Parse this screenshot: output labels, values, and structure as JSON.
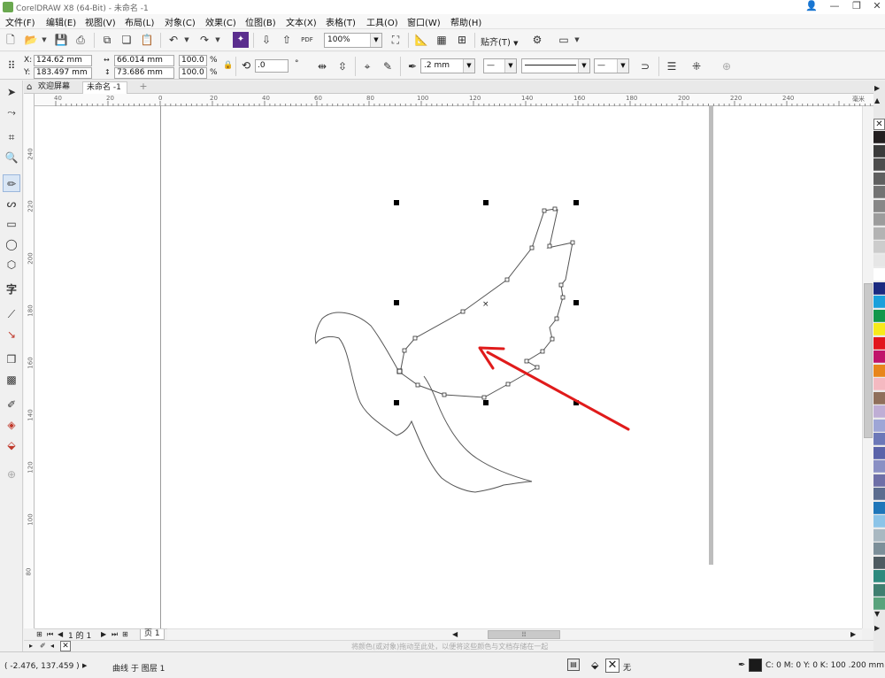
{
  "window": {
    "title": "CorelDRAW X8 (64-Bit) - 未命名 -1"
  },
  "menu": [
    "文件(F)",
    "编辑(E)",
    "视图(V)",
    "布局(L)",
    "对象(C)",
    "效果(C)",
    "位图(B)",
    "文本(X)",
    "表格(T)",
    "工具(O)",
    "窗口(W)",
    "帮助(H)"
  ],
  "toolbar": {
    "zoom": "100%",
    "snap_label": "贴齐(T)",
    "pdf_label": "PDF"
  },
  "property_bar": {
    "x": "124.62 mm",
    "y": "183.497 mm",
    "width": "66.014 mm",
    "height": "73.686 mm",
    "scale_w": "100.0",
    "scale_h": "100.0",
    "percent": "%",
    "x_label": "X:",
    "y_label": "Y:",
    "rotation": ".0",
    "outline_width": ".2 mm"
  },
  "tabs": {
    "welcome": "欢迎屏幕",
    "document": "未命名 -1"
  },
  "ruler": {
    "h_ticks": [
      "40",
      "20",
      "0",
      "20",
      "40",
      "60",
      "80",
      "100",
      "120",
      "140",
      "160",
      "180",
      "200",
      "220",
      "240"
    ],
    "h_unit": "毫米",
    "v_ticks": [
      "240",
      "220",
      "200",
      "180",
      "160",
      "140",
      "120",
      "100",
      "80"
    ]
  },
  "page_nav": {
    "current": "1",
    "of": "的",
    "total": "1",
    "page_tab": "页 1"
  },
  "hint": "将颜色(或对象)拖动至此处，以便将这些颜色与文档存储在一起",
  "status": {
    "coords": "( -2.476, 137.459 )",
    "object_info": "曲线 于 图层 1",
    "fill_none": "无",
    "outline_info": "C: 0 M: 0 Y: 0 K: 100 .200 mm"
  },
  "colors": {
    "arrow": "#e01b1b",
    "outline_swatch": "#1a1a1a",
    "palette": [
      "#231f20",
      "#3b3b3b",
      "#4d4d4d",
      "#606060",
      "#737373",
      "#878787",
      "#9c9c9c",
      "#b3b3b3",
      "#cccccc",
      "#e6e6e6",
      "#ffffff",
      "#1b2a80",
      "#1aa0db",
      "#13974b",
      "#f7ea1b",
      "#e2161d",
      "#c0146b",
      "#e8861c",
      "#f5b9c1",
      "#8f6f5b",
      "#bfaed5",
      "#9ea6d6",
      "#6c78b8",
      "#5a63a9",
      "#8a90c4",
      "#6e6fa7",
      "#5c6d8f",
      "#1f76b9",
      "#8cc4e8",
      "#a9b8c1",
      "#7c8f99",
      "#4e5b61",
      "#2e8a7e",
      "#3f7f70",
      "#59a37c"
    ]
  }
}
